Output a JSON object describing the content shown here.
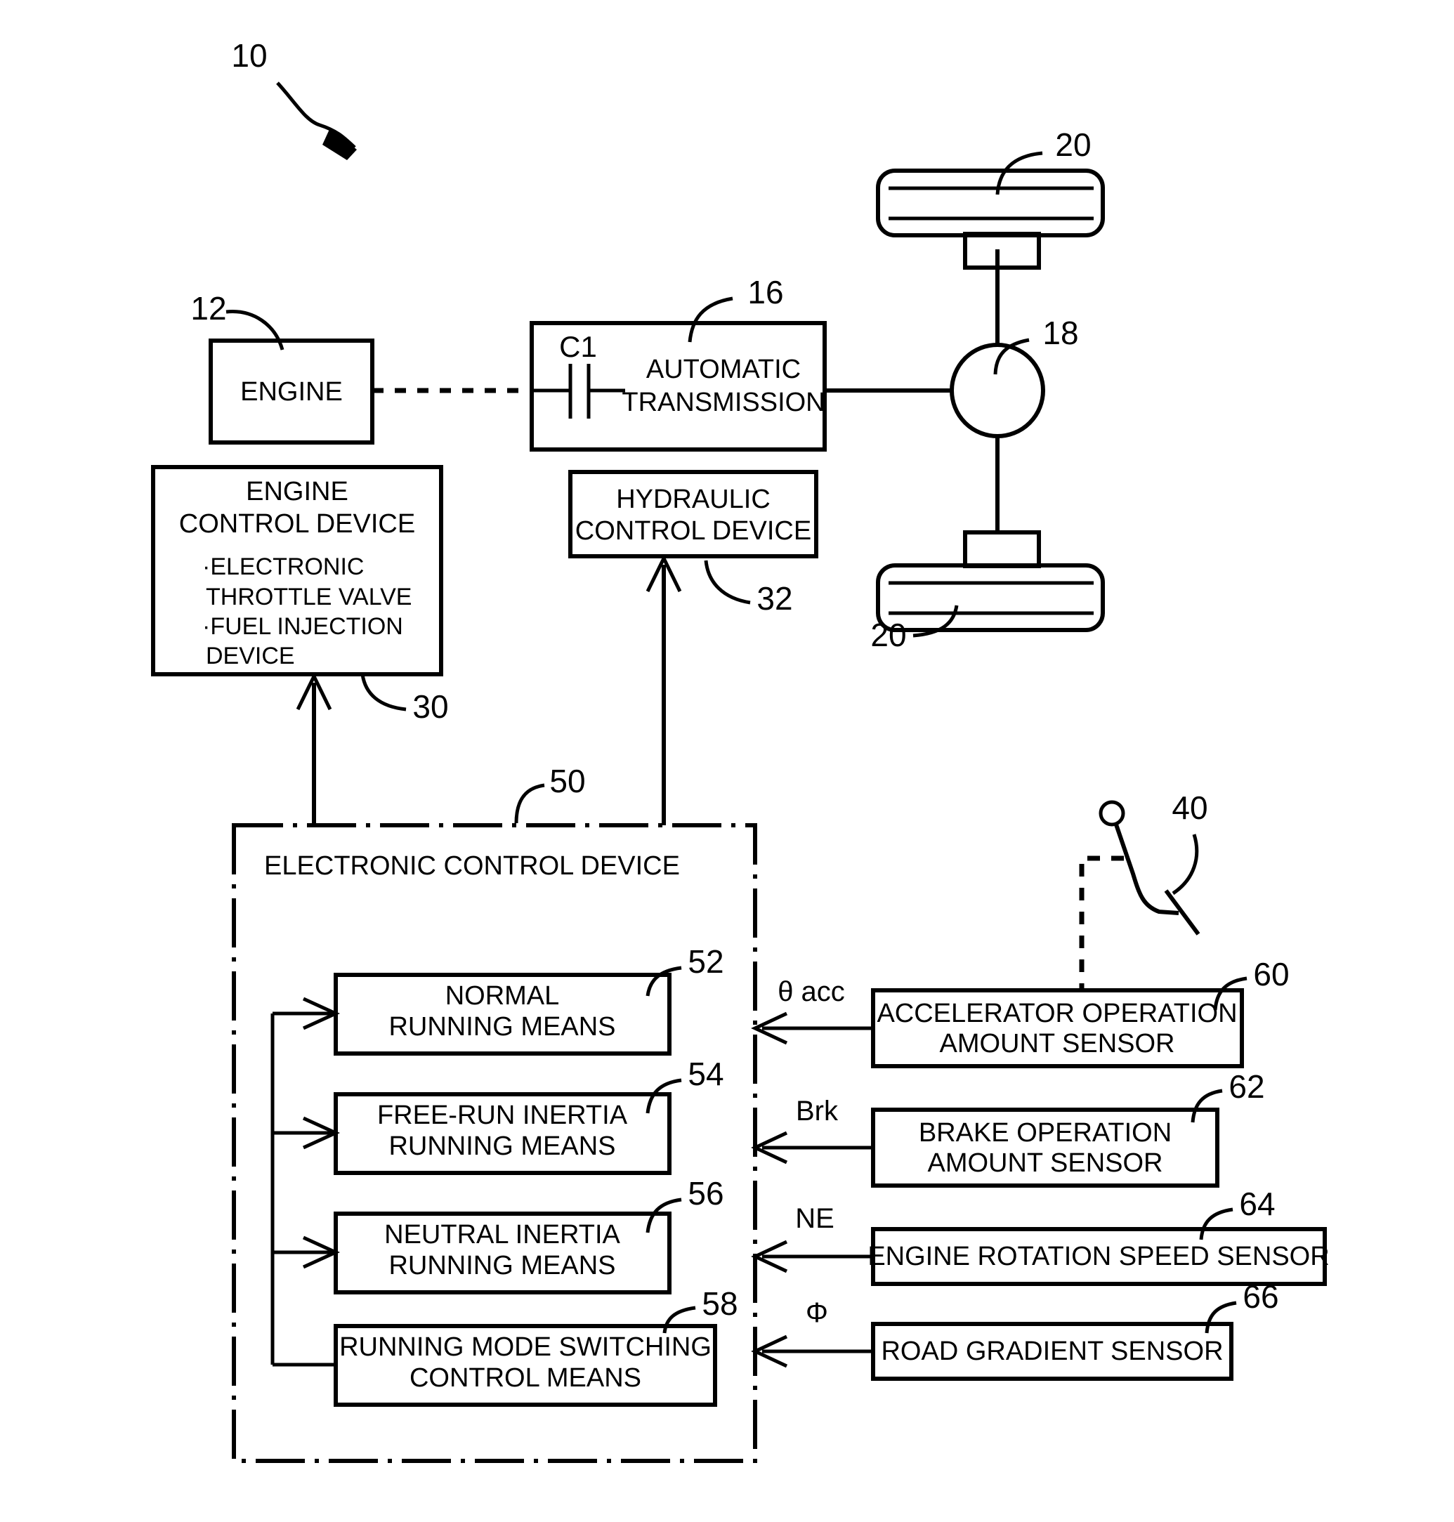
{
  "figure": {
    "kind": "patent-block-diagram",
    "overall_label": "10"
  },
  "blocks": {
    "engine": {
      "label": "ENGINE",
      "ref": "12"
    },
    "automatic_transmission": {
      "line1": "AUTOMATIC",
      "line2": "TRANSMISSION",
      "ref": "16",
      "clutch_label": "C1"
    },
    "differential": {
      "ref": "18"
    },
    "wheel_top": {
      "ref": "20"
    },
    "wheel_bottom": {
      "ref": "20"
    },
    "engine_control_device": {
      "line1": "ENGINE",
      "line2": "CONTROL DEVICE",
      "bullets": [
        "·ELECTRONIC",
        "THROTTLE VALVE",
        "·FUEL INJECTION",
        "DEVICE"
      ],
      "ref": "30"
    },
    "hydraulic_control_device": {
      "line1": "HYDRAULIC",
      "line2": "CONTROL DEVICE",
      "ref": "32"
    },
    "electronic_control_device": {
      "title": "ELECTRONIC CONTROL DEVICE",
      "ref": "50"
    },
    "accelerator_pedal": {
      "ref": "40"
    }
  },
  "means": [
    {
      "line1": "NORMAL",
      "line2": "RUNNING MEANS",
      "ref": "52"
    },
    {
      "line1": "FREE-RUN INERTIA",
      "line2": "RUNNING MEANS",
      "ref": "54"
    },
    {
      "line1": "NEUTRAL INERTIA",
      "line2": "RUNNING MEANS",
      "ref": "56"
    },
    {
      "line1": "RUNNING MODE SWITCHING",
      "line2": "CONTROL MEANS",
      "ref": "58"
    }
  ],
  "sensors": [
    {
      "line1": "ACCELERATOR OPERATION",
      "line2": "AMOUNT SENSOR",
      "ref": "60",
      "signal": "θ acc"
    },
    {
      "line1": "BRAKE OPERATION",
      "line2": "AMOUNT SENSOR",
      "ref": "62",
      "signal": "Brk"
    },
    {
      "line1": "ENGINE ROTATION SPEED SENSOR",
      "line2": "",
      "ref": "64",
      "signal": "NE"
    },
    {
      "line1": "ROAD GRADIENT SENSOR",
      "line2": "",
      "ref": "66",
      "signal": "Φ"
    }
  ],
  "colors": {
    "ink": "#000000",
    "paper": "#ffffff"
  }
}
